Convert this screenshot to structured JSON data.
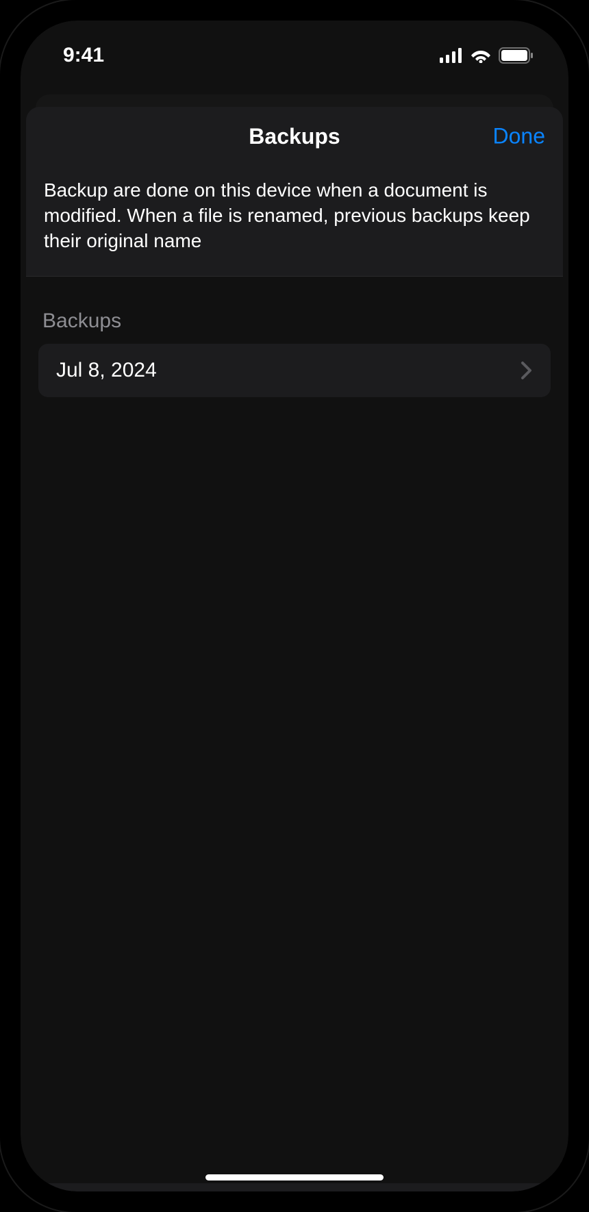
{
  "status_bar": {
    "time": "9:41"
  },
  "modal": {
    "title": "Backups",
    "done_label": "Done",
    "description": "Backup are done on this device when a document is modified. When a file is renamed, previous backups keep their original name"
  },
  "section": {
    "header": "Backups",
    "items": [
      {
        "label": "Jul 8, 2024"
      }
    ]
  }
}
